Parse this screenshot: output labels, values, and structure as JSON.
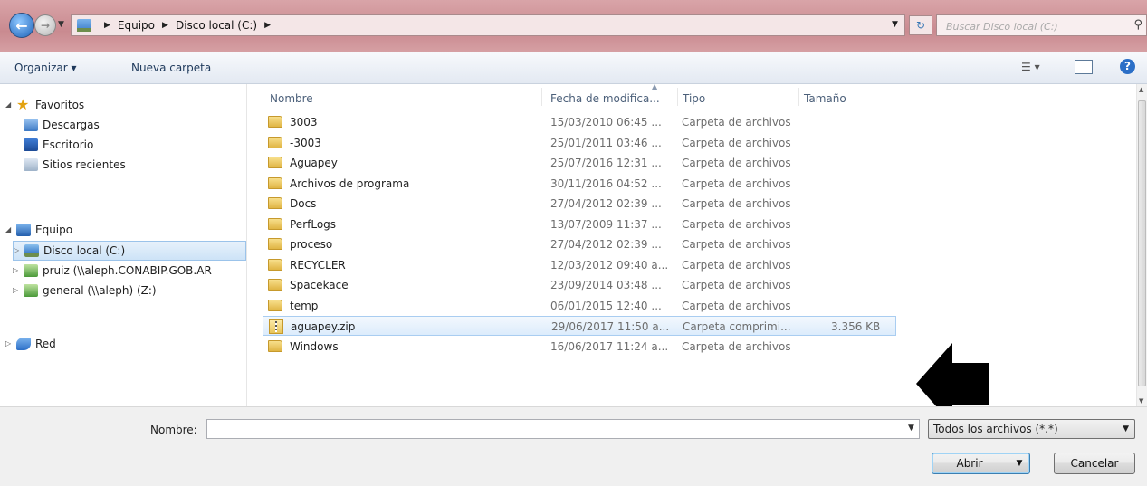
{
  "address_bar": {
    "crumbs": [
      "Equipo",
      "Disco local (C:)"
    ],
    "search_placeholder": "Buscar Disco local (C:)"
  },
  "toolbar": {
    "organize_label": "Organizar ▾",
    "new_folder_label": "Nueva carpeta"
  },
  "nav": {
    "favorites": {
      "label": "Favoritos",
      "items": [
        "Descargas",
        "Escritorio",
        "Sitios recientes"
      ]
    },
    "computer": {
      "label": "Equipo",
      "items": [
        "Disco local (C:)",
        "pruiz (\\\\aleph.CONABIP.GOB.AR",
        "general (\\\\aleph) (Z:)"
      ]
    },
    "network": {
      "label": "Red"
    }
  },
  "columns": {
    "name": "Nombre",
    "date": "Fecha de modifica...",
    "type": "Tipo",
    "size": "Tamaño"
  },
  "files": [
    {
      "name": "3003",
      "date": "15/03/2010 06:45 ...",
      "type": "Carpeta de archivos",
      "size": "",
      "kind": "folder"
    },
    {
      "name": "-3003",
      "date": "25/01/2011 03:46 ...",
      "type": "Carpeta de archivos",
      "size": "",
      "kind": "folder"
    },
    {
      "name": "Aguapey",
      "date": "25/07/2016 12:31 ...",
      "type": "Carpeta de archivos",
      "size": "",
      "kind": "folder"
    },
    {
      "name": "Archivos de programa",
      "date": "30/11/2016 04:52 ...",
      "type": "Carpeta de archivos",
      "size": "",
      "kind": "folder"
    },
    {
      "name": "Docs",
      "date": "27/04/2012 02:39 ...",
      "type": "Carpeta de archivos",
      "size": "",
      "kind": "folder"
    },
    {
      "name": "PerfLogs",
      "date": "13/07/2009 11:37 ...",
      "type": "Carpeta de archivos",
      "size": "",
      "kind": "folder"
    },
    {
      "name": "proceso",
      "date": "27/04/2012 02:39 ...",
      "type": "Carpeta de archivos",
      "size": "",
      "kind": "folder"
    },
    {
      "name": "RECYCLER",
      "date": "12/03/2012 09:40 a...",
      "type": "Carpeta de archivos",
      "size": "",
      "kind": "folder"
    },
    {
      "name": "Spacekace",
      "date": "23/09/2014 03:48 ...",
      "type": "Carpeta de archivos",
      "size": "",
      "kind": "folder"
    },
    {
      "name": "temp",
      "date": "06/01/2015 12:40 ...",
      "type": "Carpeta de archivos",
      "size": "",
      "kind": "folder"
    },
    {
      "name": "aguapey.zip",
      "date": "29/06/2017 11:50 a...",
      "type": "Carpeta comprimi...",
      "size": "3.356 KB",
      "kind": "zip",
      "selected": true
    },
    {
      "name": "Windows",
      "date": "16/06/2017 11:24 a...",
      "type": "Carpeta de archivos",
      "size": "",
      "kind": "folder"
    }
  ],
  "footer": {
    "name_label": "Nombre:",
    "name_value": "",
    "filter_value": "Todos los archivos (*.*)",
    "open_label": "Abrir",
    "cancel_label": "Cancelar"
  },
  "colors": {
    "accent": "#2b6fc7",
    "titlebar": "#c98a90",
    "selection": "#dcecfc"
  }
}
